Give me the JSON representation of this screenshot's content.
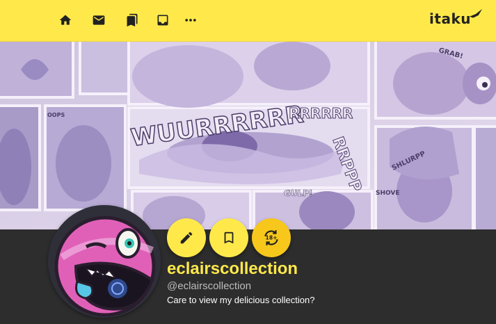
{
  "header": {
    "logo_text": "itaku",
    "nav": [
      {
        "name": "home",
        "icon": "home-icon"
      },
      {
        "name": "messages",
        "icon": "mail-icon"
      },
      {
        "name": "collections",
        "icon": "bookmarks-icon"
      },
      {
        "name": "inbox",
        "icon": "inbox-icon"
      },
      {
        "name": "more",
        "icon": "more-horiz-icon"
      }
    ]
  },
  "profile": {
    "display_name": "eclairscollection",
    "handle": "@eclairscollection",
    "bio": "Care to view my delicious collection?",
    "actions": [
      {
        "name": "edit",
        "icon": "pencil-icon"
      },
      {
        "name": "bookmark",
        "icon": "bookmark-icon"
      },
      {
        "name": "nsfw-toggle",
        "icon": "18-plus-icon",
        "label": "18+"
      }
    ]
  },
  "banner": {
    "sound_effects": [
      "WUURRRRRR",
      "RRRRRR",
      "RRPPP",
      "GULP!",
      "GRAB!",
      "SHLURPP",
      "SHOVE",
      "OOPS"
    ]
  },
  "colors": {
    "accent": "#ffe94a",
    "accent_alt": "#f7c81b",
    "background": "#2d2d2d",
    "banner_tint": "#d8cde6"
  }
}
